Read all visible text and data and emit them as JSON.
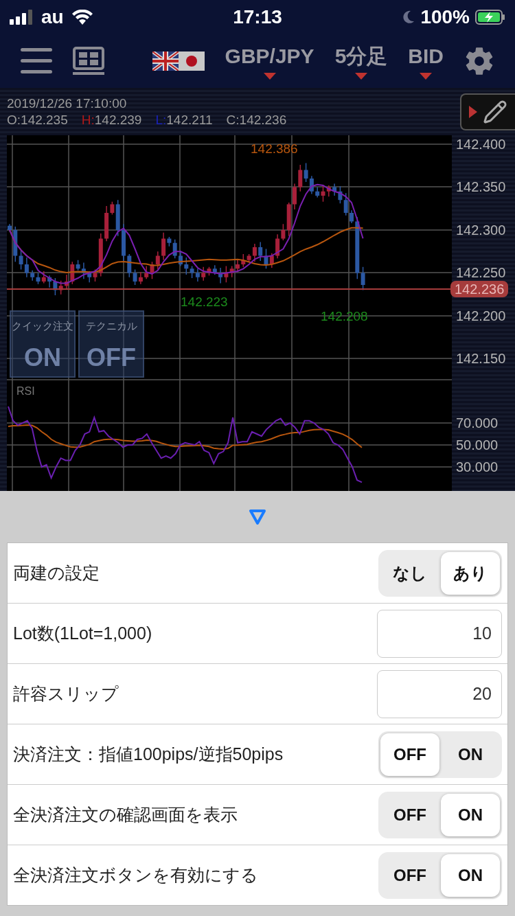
{
  "status_bar": {
    "carrier": "au",
    "time": "17:13",
    "battery": "100%"
  },
  "toolbar": {
    "pair": "GBP/JPY",
    "timeframe": "5分足",
    "price_type": "BID"
  },
  "chart_header": {
    "datetime": "2019/12/26 17:10:00",
    "ohlc": [
      {
        "kind": "open",
        "label": "O:",
        "value": "142.235"
      },
      {
        "kind": "high",
        "label": "H:",
        "value": "142.239"
      },
      {
        "kind": "low",
        "label": "L:",
        "value": "142.211"
      },
      {
        "kind": "close",
        "label": "C:",
        "value": "142.236"
      }
    ]
  },
  "chart": {
    "price_ticks": [
      "142.400",
      "142.350",
      "142.300",
      "142.250",
      "142.200",
      "142.150"
    ],
    "current_price": "142.236",
    "high_marker": "142.386",
    "low_markers": [
      "142.223",
      "142.208"
    ],
    "rsi_label": "RSI",
    "rsi_ticks": [
      "70.000",
      "50.000",
      "30.000"
    ],
    "overlay_buttons": [
      {
        "label": "クイック注文",
        "value": "ON"
      },
      {
        "label": "テクニカル",
        "value": "OFF"
      }
    ]
  },
  "settings": [
    {
      "kind": "segment",
      "label": "両建の設定",
      "options": [
        {
          "label": "なし",
          "selected": false
        },
        {
          "label": "あり",
          "selected": true
        }
      ]
    },
    {
      "kind": "input",
      "label": "Lot数(1Lot=1,000)",
      "value": "10"
    },
    {
      "kind": "input",
      "label": "許容スリップ",
      "value": "20"
    },
    {
      "kind": "segment",
      "label": "決済注文：指値100pips/逆指50pips",
      "options": [
        {
          "label": "OFF",
          "selected": true
        },
        {
          "label": "ON",
          "selected": false
        }
      ]
    },
    {
      "kind": "segment",
      "label": "全決済注文の確認画面を表示",
      "options": [
        {
          "label": "OFF",
          "selected": false
        },
        {
          "label": "ON",
          "selected": true
        }
      ]
    },
    {
      "kind": "segment",
      "label": "全決済注文ボタンを有効にする",
      "options": [
        {
          "label": "OFF",
          "selected": false
        },
        {
          "label": "ON",
          "selected": true
        }
      ]
    }
  ]
}
